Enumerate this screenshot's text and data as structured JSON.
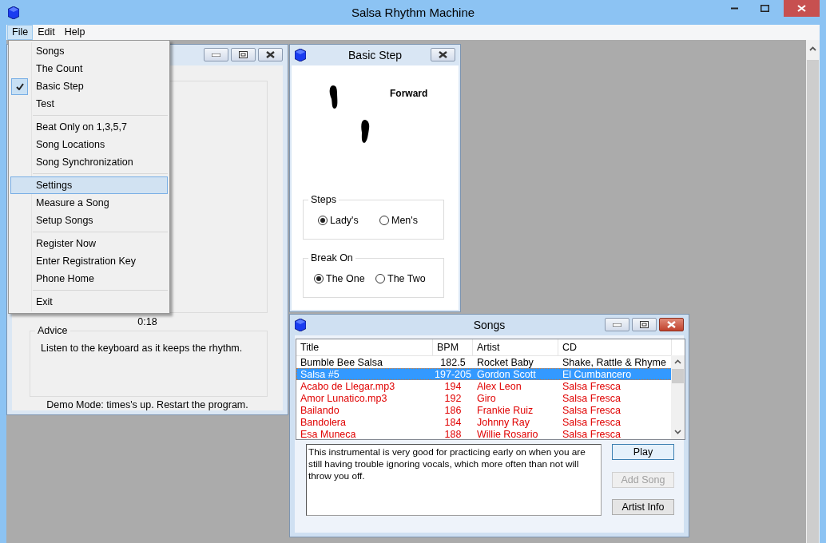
{
  "window": {
    "title": "Salsa Rhythm Machine"
  },
  "menu_bar": [
    {
      "label": "File",
      "selected": true
    },
    {
      "label": "Edit",
      "selected": false
    },
    {
      "label": "Help",
      "selected": false
    }
  ],
  "file_menu": {
    "groups": [
      [
        {
          "label": "Songs",
          "checked": false,
          "selected": false
        },
        {
          "label": "The Count",
          "checked": false,
          "selected": false
        },
        {
          "label": "Basic Step",
          "checked": true,
          "selected": false
        },
        {
          "label": "Test",
          "checked": false,
          "selected": false
        }
      ],
      [
        {
          "label": "Beat Only on 1,3,5,7",
          "checked": false,
          "selected": false
        },
        {
          "label": "Song Locations",
          "checked": false,
          "selected": false
        },
        {
          "label": "Song Synchronization",
          "checked": false,
          "selected": false
        }
      ],
      [
        {
          "label": "Settings",
          "checked": false,
          "selected": true
        },
        {
          "label": "Measure a Song",
          "checked": false,
          "selected": false
        },
        {
          "label": "Setup Songs",
          "checked": false,
          "selected": false
        }
      ],
      [
        {
          "label": "Register Now",
          "checked": false,
          "selected": false
        },
        {
          "label": "Enter Registration Key",
          "checked": false,
          "selected": false
        },
        {
          "label": "Phone Home",
          "checked": false,
          "selected": false
        }
      ],
      [
        {
          "label": "Exit",
          "checked": false,
          "selected": false
        }
      ]
    ]
  },
  "main_window": {
    "timer": "0:18",
    "advice": {
      "title": "Advice",
      "text": "Listen to the keyboard as it keeps the rhythm."
    },
    "status": "Demo Mode: times's up. Restart the program."
  },
  "basic_step_window": {
    "title": "Basic Step",
    "direction": "Forward",
    "steps": {
      "title": "Steps",
      "options": [
        {
          "label": "Lady's",
          "selected": true
        },
        {
          "label": "Men's",
          "selected": false
        }
      ]
    },
    "break_on": {
      "title": "Break On",
      "options": [
        {
          "label": "The One",
          "selected": true
        },
        {
          "label": "The Two",
          "selected": false
        }
      ]
    }
  },
  "songs_window": {
    "title": "Songs",
    "columns": [
      "Title",
      "BPM",
      "Artist",
      "CD"
    ],
    "rows": [
      {
        "title": "Bumble Bee Salsa",
        "bpm": "182.5",
        "artist": "Rocket Baby",
        "cd": "Shake, Rattle & Rhyme",
        "kind": "plain",
        "selected": false
      },
      {
        "title": "Salsa #5",
        "bpm": "197-205",
        "artist": "Gordon Scott",
        "cd": "El Cumbancero",
        "kind": "plain",
        "selected": true
      },
      {
        "title": "Acabo de Llegar.mp3",
        "bpm": "194",
        "artist": "Alex Leon",
        "cd": "Salsa Fresca",
        "kind": "flagged",
        "selected": false
      },
      {
        "title": "Amor Lunatico.mp3",
        "bpm": "192",
        "artist": "Giro",
        "cd": "Salsa Fresca",
        "kind": "flagged",
        "selected": false
      },
      {
        "title": "Bailando",
        "bpm": "186",
        "artist": "Frankie Ruiz",
        "cd": "Salsa Fresca",
        "kind": "flagged",
        "selected": false
      },
      {
        "title": "Bandolera",
        "bpm": "184",
        "artist": "Johnny Ray",
        "cd": "Salsa Fresca",
        "kind": "flagged",
        "selected": false
      },
      {
        "title": "Esa Muneca",
        "bpm": "188",
        "artist": "Willie Rosario",
        "cd": "Salsa Fresca",
        "kind": "flagged",
        "selected": false
      }
    ],
    "description": "This instrumental is very good for practicing early on when you are still having trouble ignoring vocals, which more often than not will throw you off.",
    "buttons": [
      {
        "label": "Play",
        "default": true,
        "disabled": false
      },
      {
        "label": "Add Song",
        "default": false,
        "disabled": true
      },
      {
        "label": "Artist Info",
        "default": false,
        "disabled": false
      }
    ]
  }
}
